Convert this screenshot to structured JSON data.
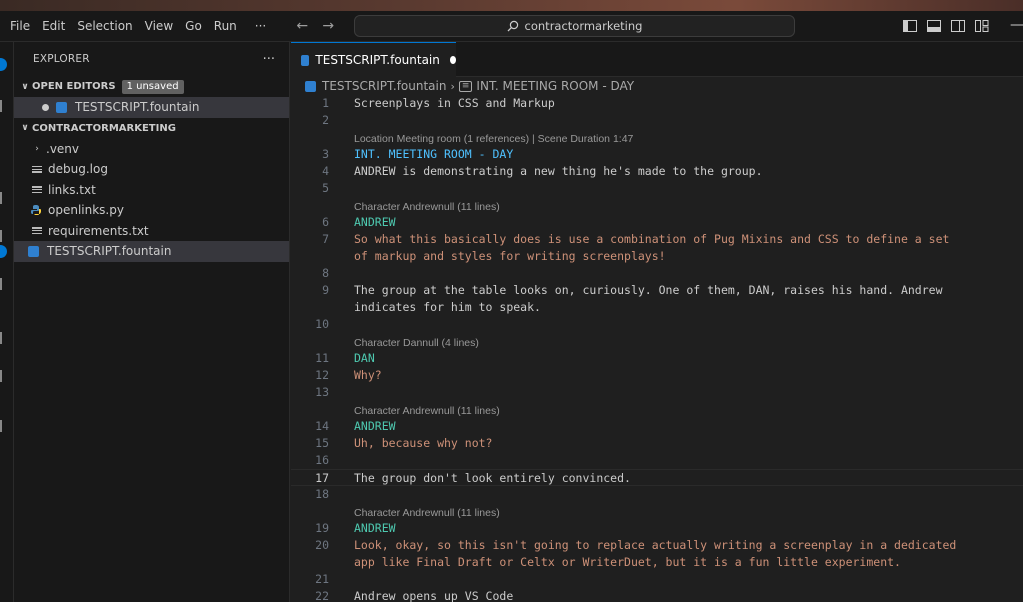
{
  "menu": [
    "File",
    "Edit",
    "Selection",
    "View",
    "Go",
    "Run",
    "···"
  ],
  "search": {
    "text": "contractormarketing"
  },
  "sidebar": {
    "title": "EXPLORER",
    "more": "···",
    "open_editors": {
      "label": "OPEN EDITORS",
      "badge": "1 unsaved",
      "files": [
        "TESTSCRIPT.fountain"
      ]
    },
    "project": {
      "label": "CONTRACTORMARKETING",
      "items": [
        ".venv",
        "debug.log",
        "links.txt",
        "openlinks.py",
        "requirements.txt",
        "TESTSCRIPT.fountain"
      ]
    }
  },
  "editor": {
    "tab": {
      "label": "TESTSCRIPT.fountain"
    },
    "breadcrumb": {
      "file": "TESTSCRIPT.fountain",
      "symbol": "INT. MEETING ROOM - DAY"
    },
    "current_line": "17",
    "lines": [
      {
        "n": "1",
        "text": "Screenplays in CSS and Markup",
        "kind": "action"
      },
      {
        "n": "2",
        "text": "",
        "kind": "action"
      },
      {
        "lens": "Location Meeting room (1 references) | Scene Duration 1:47"
      },
      {
        "n": "3",
        "text": "INT. MEETING ROOM - DAY",
        "kind": "scene"
      },
      {
        "n": "4",
        "text": "ANDREW is demonstrating a new thing he's made to the group.",
        "kind": "action"
      },
      {
        "n": "5",
        "text": "",
        "kind": "action"
      },
      {
        "lens": "Character Andrewnull (11 lines)"
      },
      {
        "n": "6",
        "text": "ANDREW",
        "kind": "char"
      },
      {
        "n": "7",
        "text": "So what this basically does is use a combination of Pug Mixins and CSS to define a set",
        "kind": "dlg"
      },
      {
        "n": "",
        "text": "of markup and styles for writing screenplays!",
        "kind": "dlg"
      },
      {
        "n": "8",
        "text": "",
        "kind": "action"
      },
      {
        "n": "9",
        "text": "The group at the table looks on, curiously. One of them, DAN, raises his hand. Andrew",
        "kind": "action"
      },
      {
        "n": "",
        "text": "indicates for him to speak.",
        "kind": "action"
      },
      {
        "n": "10",
        "text": "",
        "kind": "action"
      },
      {
        "lens": "Character Dannull (4 lines)"
      },
      {
        "n": "11",
        "text": "DAN",
        "kind": "char"
      },
      {
        "n": "12",
        "text": "Why?",
        "kind": "dlg"
      },
      {
        "n": "13",
        "text": "",
        "kind": "action"
      },
      {
        "lens": "Character Andrewnull (11 lines)"
      },
      {
        "n": "14",
        "text": "ANDREW",
        "kind": "char"
      },
      {
        "n": "15",
        "text": "Uh, because why not?",
        "kind": "dlg"
      },
      {
        "n": "16",
        "text": "",
        "kind": "action"
      },
      {
        "n": "17",
        "text": "The group don't look entirely convinced.",
        "kind": "action"
      },
      {
        "n": "18",
        "text": "",
        "kind": "action"
      },
      {
        "lens": "Character Andrewnull (11 lines)"
      },
      {
        "n": "19",
        "text": "ANDREW",
        "kind": "char"
      },
      {
        "n": "20",
        "text": "Look, okay, so this isn't going to replace actually writing a screenplay in a dedicated",
        "kind": "dlg"
      },
      {
        "n": "",
        "text": "app like Final Draft or Celtx or WriterDuet, but it is a fun little experiment.",
        "kind": "dlg"
      },
      {
        "n": "21",
        "text": "",
        "kind": "action"
      },
      {
        "n": "22",
        "text": "Andrew opens up VS Code",
        "kind": "action"
      }
    ]
  },
  "colors": {
    "accent": "#0078d4",
    "scene": "#4fc1ff",
    "character": "#4ec9b0",
    "dialogue": "#ce9178"
  }
}
